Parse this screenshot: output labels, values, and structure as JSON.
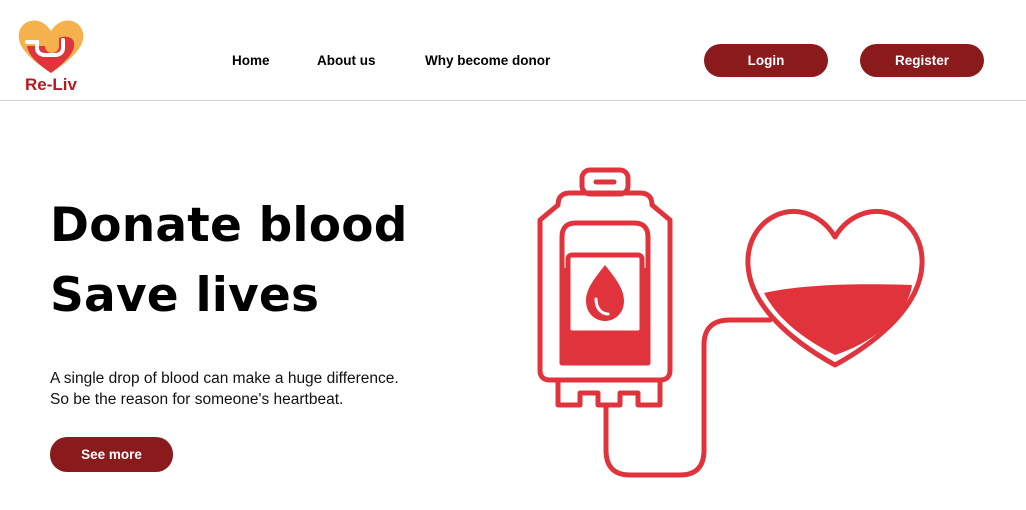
{
  "brand": {
    "name": "Re-Liv"
  },
  "nav": {
    "links": [
      "Home",
      "About us",
      "Why become donor"
    ]
  },
  "auth": {
    "login_label": "Login",
    "register_label": "Register"
  },
  "hero": {
    "title_line1": "Donate blood",
    "title_line2": "Save lives",
    "subtitle_line1": "A single drop of blood can make a huge difference.",
    "subtitle_line2": "So be the reason for someone's heartbeat.",
    "cta_label": "See more"
  },
  "colors": {
    "brand_dark_red": "#8b1a1c",
    "illustration_red": "#e0333c",
    "logo_orange": "#f4b14c"
  }
}
